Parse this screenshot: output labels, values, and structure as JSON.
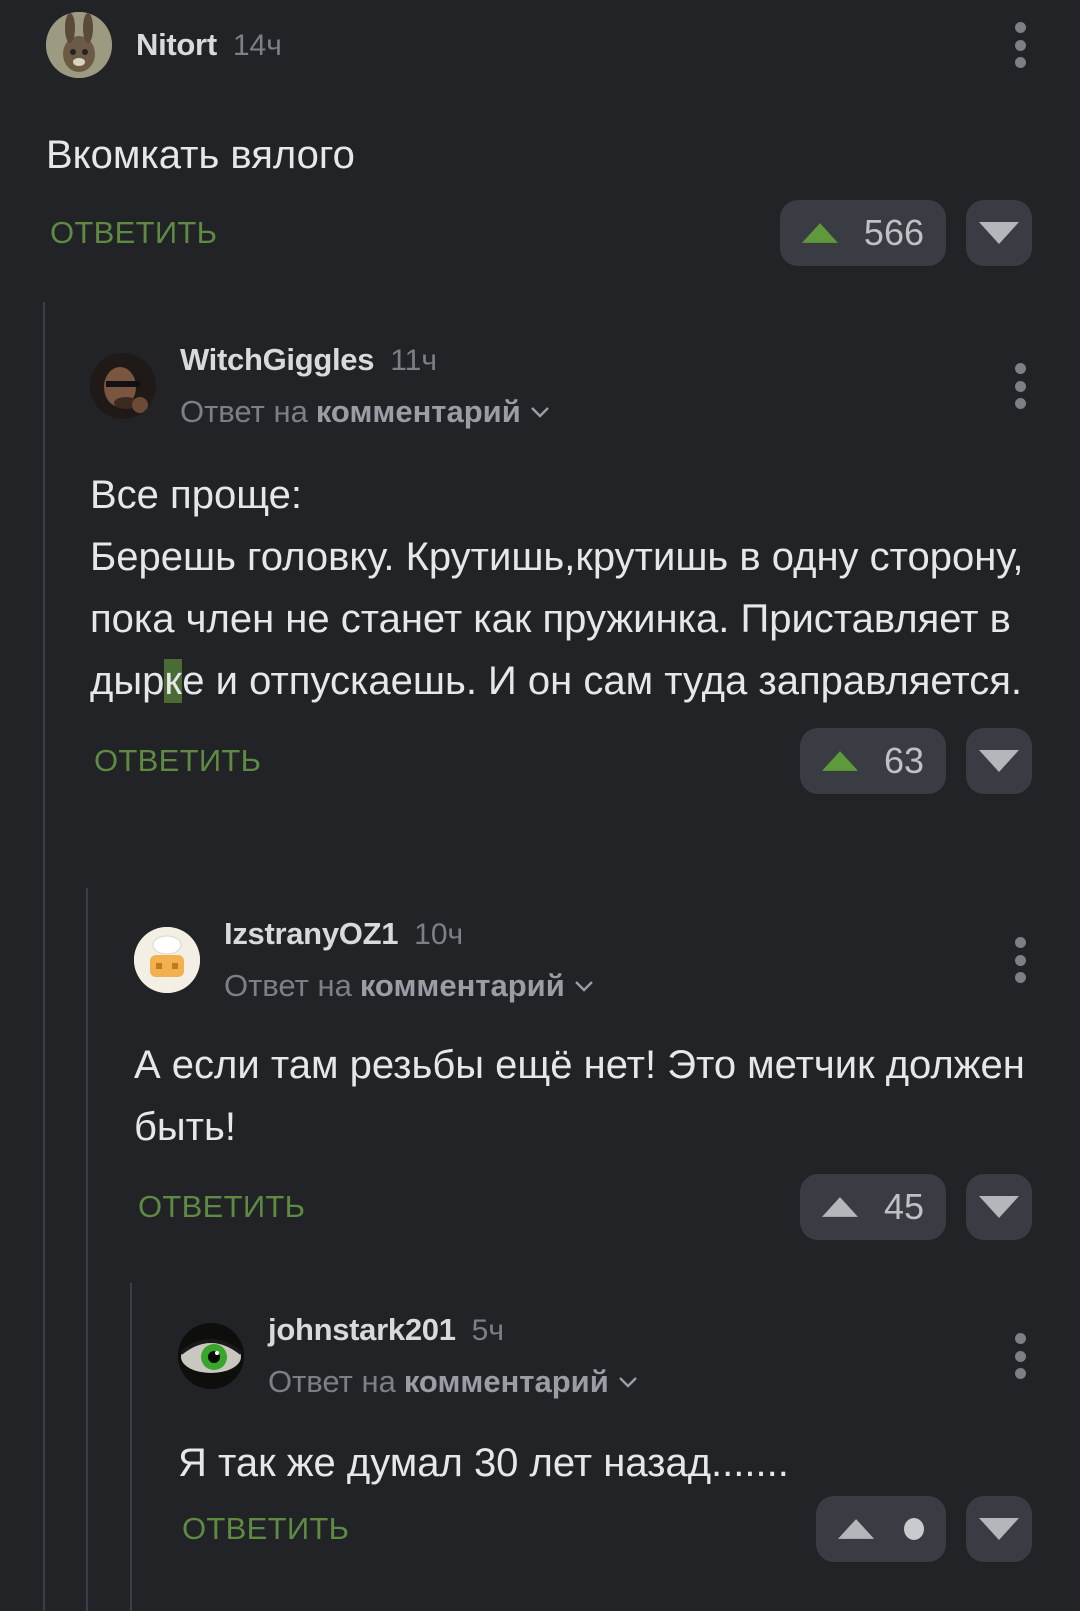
{
  "colors": {
    "background": "#212327",
    "accent_green": "#5e8a42",
    "upvote_active": "#5e9a3c",
    "upvote_inactive": "#b4b6ba",
    "button_bg": "#393c42"
  },
  "comments": [
    {
      "username": "Nitort",
      "time": "14ч",
      "reply_to": null,
      "body": "Вкомкать вялого",
      "reply_label": "ОТВЕТИТЬ",
      "score": "566",
      "upvoted": true,
      "avatar_icon": "hare-icon"
    },
    {
      "username": "WitchGiggles",
      "time": "11ч",
      "reply_to": {
        "prefix": "Ответ на",
        "target": "комментарий"
      },
      "body_pre": "Все проще:\nБерешь головку. Крутишь,крутишь в одну сторону, пока член не станет как пружинка. Приставляет в дыр",
      "body_hl": "к",
      "body_post": "е и отпускаешь. И он сам туда заправляется.",
      "reply_label": "ОТВЕТИТЬ",
      "score": "63",
      "upvoted": true,
      "avatar_icon": "portrait-icon"
    },
    {
      "username": "IzstranyOZ1",
      "time": "10ч",
      "reply_to": {
        "prefix": "Ответ на",
        "target": "комментарий"
      },
      "body": "А если там резьбы ещё нет! Это метчик должен быть!",
      "reply_label": "ОТВЕТИТЬ",
      "score": "45",
      "upvoted": false,
      "avatar_icon": "chef-hat-icon"
    },
    {
      "username": "johnstark201",
      "time": "5ч",
      "reply_to": {
        "prefix": "Ответ на",
        "target": "комментарий"
      },
      "body": "Я так же думал 30 лет назад.......",
      "reply_label": "ОТВЕТИТЬ",
      "score": null,
      "upvoted": false,
      "avatar_icon": "green-eye-icon"
    }
  ]
}
